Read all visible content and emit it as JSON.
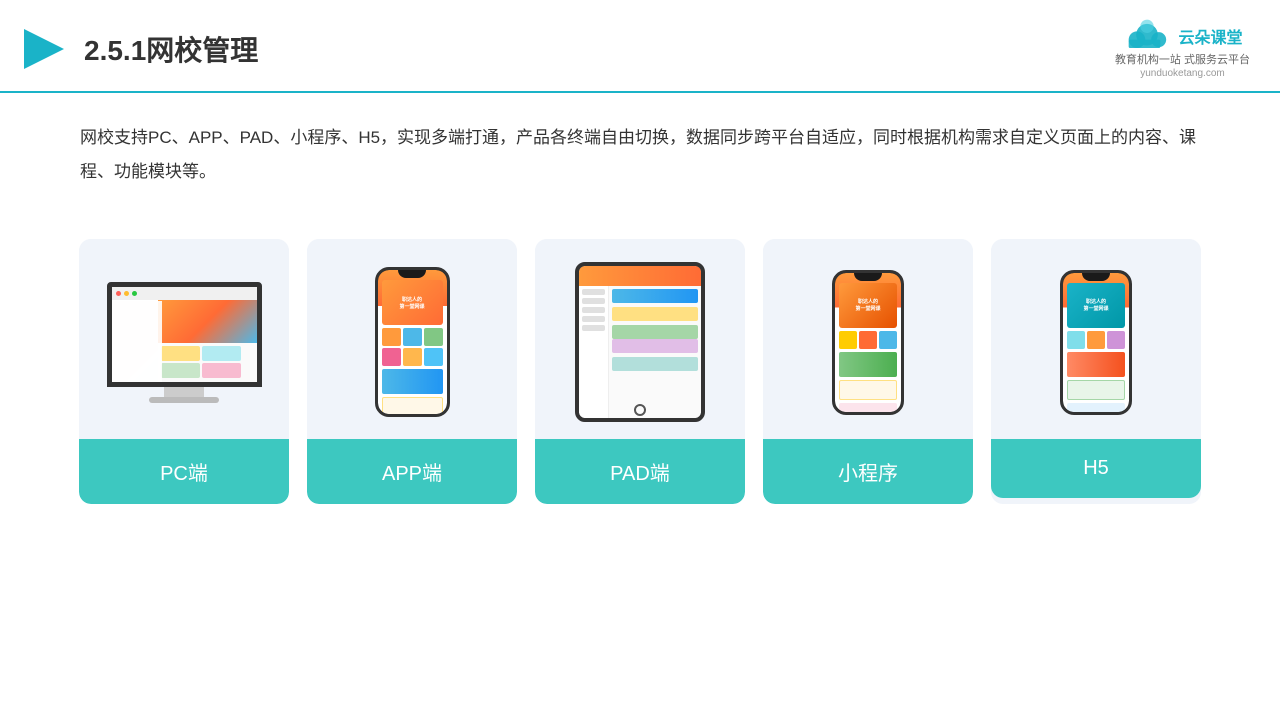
{
  "header": {
    "section_number": "2.5.1",
    "title": "网校管理",
    "logo": {
      "brand": "云朵课堂",
      "url": "yunduoketang.com",
      "tagline": "教育机构一站\n式服务云平台"
    }
  },
  "description": {
    "text": "网校支持PC、APP、PAD、小程序、H5，实现多端打通，产品各终端自由切换，数据同步跨平台自适应，同时根据机构需求自定义页面上的内容、课程、功能模块等。"
  },
  "cards": [
    {
      "id": "pc",
      "label": "PC端"
    },
    {
      "id": "app",
      "label": "APP端"
    },
    {
      "id": "pad",
      "label": "PAD端"
    },
    {
      "id": "miniprogram",
      "label": "小程序"
    },
    {
      "id": "h5",
      "label": "H5"
    }
  ],
  "accent_color": "#3dc8c0",
  "header_line_color": "#1ab3c8"
}
